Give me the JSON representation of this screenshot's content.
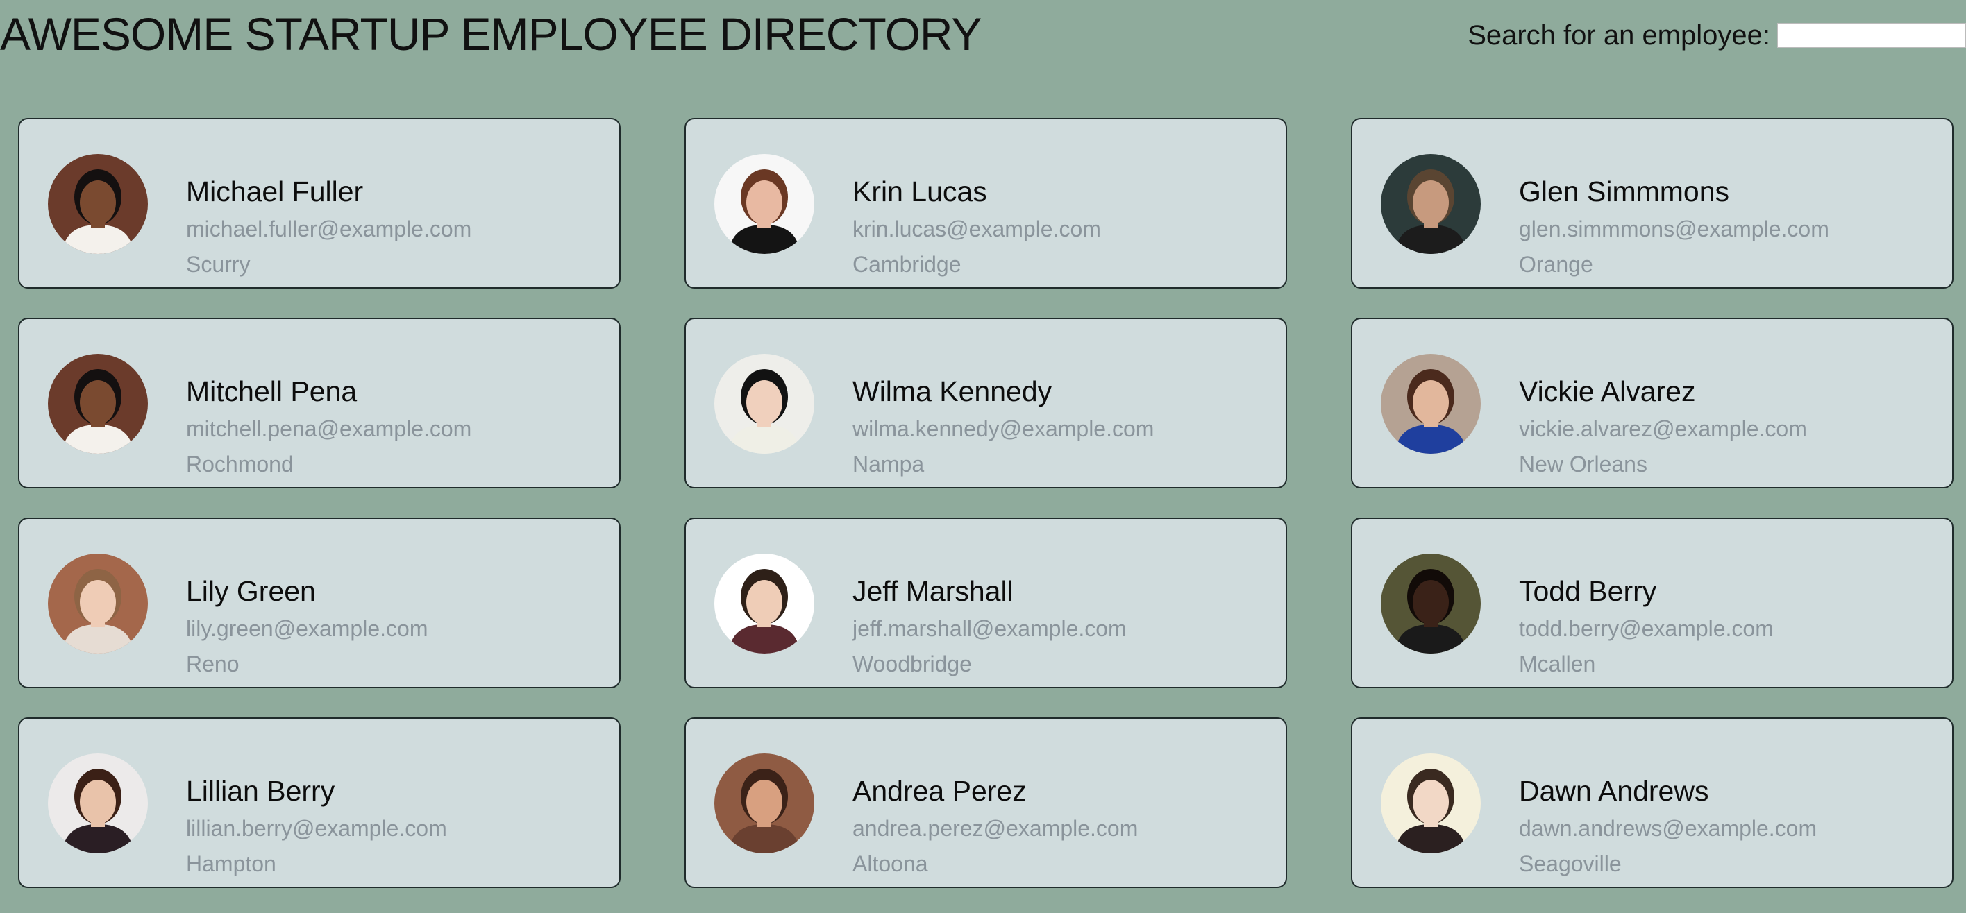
{
  "header": {
    "title": "AWESOME STARTUP EMPLOYEE DIRECTORY",
    "search_label": "Search for an employee:",
    "search_value": ""
  },
  "employees": [
    {
      "name": "Michael Fuller",
      "email": "michael.fuller@example.com",
      "city": "Scurry",
      "avatar": {
        "bg": "#6b3b2b",
        "skin": "#7a4a30",
        "hair": "#141010",
        "shirt": "#f4f1ec"
      }
    },
    {
      "name": "Krin Lucas",
      "email": "krin.lucas@example.com",
      "city": "Cambridge",
      "avatar": {
        "bg": "#f7f7f7",
        "skin": "#e8b9a2",
        "hair": "#6a3824",
        "shirt": "#141414"
      }
    },
    {
      "name": "Glen Simmmons",
      "email": "glen.simmmons@example.com",
      "city": "Orange",
      "avatar": {
        "bg": "#2c3b3a",
        "skin": "#c79a7e",
        "hair": "#5a4532",
        "shirt": "#1c1c1c"
      }
    },
    {
      "name": "Mitchell Pena",
      "email": "mitchell.pena@example.com",
      "city": "Rochmond",
      "avatar": {
        "bg": "#6b3b2b",
        "skin": "#7a4a30",
        "hair": "#141010",
        "shirt": "#f4f1ec"
      }
    },
    {
      "name": "Wilma Kennedy",
      "email": "wilma.kennedy@example.com",
      "city": "Nampa",
      "avatar": {
        "bg": "#eeeeea",
        "skin": "#f0d0bd",
        "hair": "#121212",
        "shirt": "#efefe6"
      }
    },
    {
      "name": "Vickie Alvarez",
      "email": "vickie.alvarez@example.com",
      "city": "New Orleans",
      "avatar": {
        "bg": "#b5a293",
        "skin": "#e2b79c",
        "hair": "#4b2a1d",
        "shirt": "#1f3f9e"
      }
    },
    {
      "name": "Lily Green",
      "email": "lily.green@example.com",
      "city": "Reno",
      "avatar": {
        "bg": "#a4674b",
        "skin": "#efccb6",
        "hair": "#8e6445",
        "shirt": "#e6dcd3"
      }
    },
    {
      "name": "Jeff Marshall",
      "email": "jeff.marshall@example.com",
      "city": "Woodbridge",
      "avatar": {
        "bg": "#ffffff",
        "skin": "#efcdb7",
        "hair": "#2e2018",
        "shirt": "#5a2a30"
      }
    },
    {
      "name": "Todd Berry",
      "email": "todd.berry@example.com",
      "city": "Mcallen",
      "avatar": {
        "bg": "#555536",
        "skin": "#3a2218",
        "hair": "#120b08",
        "shirt": "#1a1a1a"
      }
    },
    {
      "name": "Lillian Berry",
      "email": "lillian.berry@example.com",
      "city": "Hampton",
      "avatar": {
        "bg": "#eceaea",
        "skin": "#e9c3aa",
        "hair": "#3b2016",
        "shirt": "#2a1e24"
      }
    },
    {
      "name": "Andrea Perez",
      "email": "andrea.perez@example.com",
      "city": "Altoona",
      "avatar": {
        "bg": "#8f5b43",
        "skin": "#d8a080",
        "hair": "#3b2218",
        "shirt": "#6a4030"
      }
    },
    {
      "name": "Dawn Andrews",
      "email": "dawn.andrews@example.com",
      "city": "Seagoville",
      "avatar": {
        "bg": "#f4f0dc",
        "skin": "#f2d8c6",
        "hair": "#3a2a20",
        "shirt": "#2b2020"
      }
    }
  ]
}
